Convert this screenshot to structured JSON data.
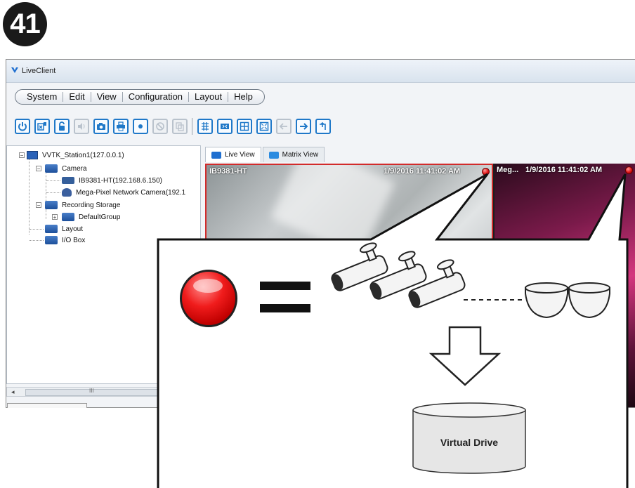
{
  "step_number": "41",
  "window": {
    "title": "LiveClient"
  },
  "menu": [
    "System",
    "Edit",
    "View",
    "Configuration",
    "Layout",
    "Help"
  ],
  "toolbar": {
    "buttons": [
      {
        "icon": "power-icon",
        "enabled": true
      },
      {
        "icon": "logout-icon",
        "enabled": true
      },
      {
        "icon": "lock-icon",
        "enabled": true
      },
      {
        "icon": "speaker-icon",
        "enabled": false
      },
      {
        "icon": "snapshot-icon",
        "enabled": true
      },
      {
        "icon": "print-icon",
        "enabled": true
      },
      {
        "icon": "record-icon",
        "enabled": true
      },
      {
        "icon": "no-entry-icon",
        "enabled": false
      },
      {
        "icon": "copy-icon",
        "enabled": false
      },
      {
        "icon": "tile-icon",
        "enabled": true
      },
      {
        "icon": "fullscreen-icon",
        "enabled": true
      },
      {
        "icon": "layout-icon",
        "enabled": true
      },
      {
        "icon": "fit-icon",
        "enabled": true
      },
      {
        "icon": "back-arrow-icon",
        "enabled": false
      },
      {
        "icon": "forward-arrow-icon",
        "enabled": true
      },
      {
        "icon": "restore-icon",
        "enabled": true
      }
    ]
  },
  "tree": {
    "station": "VVTK_Station1(127.0.0.1)",
    "camera_group": "Camera",
    "camera_1": "IB9381-HT(192.168.6.150)",
    "camera_2": "Mega-Pixel Network Camera(192.1",
    "recording_storage": "Recording Storage",
    "default_group": "DefaultGroup",
    "layout": "Layout",
    "io_box": "I/O Box"
  },
  "scrollbar": {
    "arrow": "◂",
    "grip": "III"
  },
  "tabs": {
    "live_view": "Live View",
    "matrix_view": "Matrix View"
  },
  "video": {
    "cam1_name": "IB9381-HT",
    "cam1_time": "1/9/2016 11:41:02 AM",
    "cam2_name": "Meg...",
    "cam2_time": "1/9/2016 11:41:02 AM"
  },
  "callout": {
    "drive_label": "Virtual Drive"
  },
  "colors": {
    "recording": "#e01616",
    "accent": "#1f78c8"
  }
}
